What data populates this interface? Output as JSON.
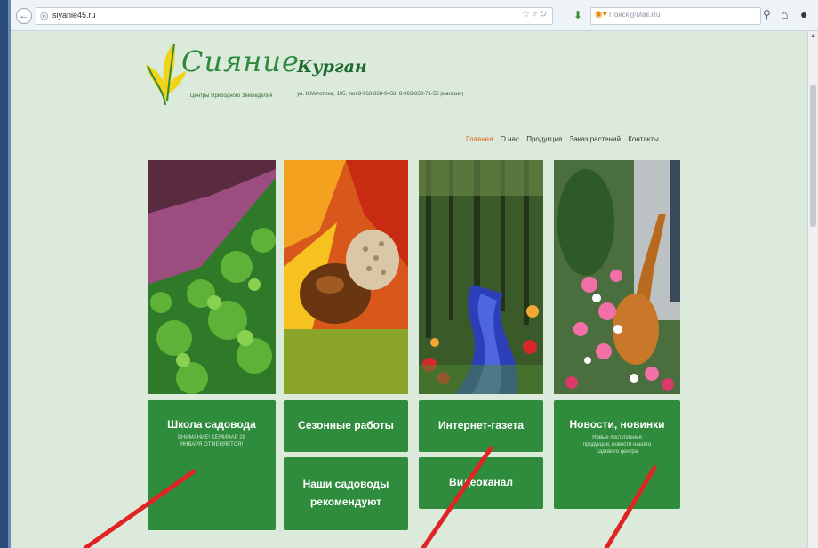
{
  "browser": {
    "url": "siyanie45.ru",
    "search_placeholder": "Поиск@Mail.Ru"
  },
  "site": {
    "logo_word": "Сияние",
    "logo_sub": "Центры Природного Земледелия",
    "city": "Курган",
    "address": "ул. К.Мяготина, 105, тел.8-963-868-0458, 8-963-838-71-55 (магазин)"
  },
  "nav": [
    "Главная",
    "О нас",
    "Продукция",
    "Заказ растений",
    "Контакты"
  ],
  "tiles": {
    "school_title": "Школа садовода",
    "school_sub": "ВНИМАНИЕ! СЕМИНАР 28 ЯНВАРЯ ОТМЕНЯЕТСЯ!",
    "seasonal": "Сезонные работы",
    "gardeners": "Наши садоводы рекомендуют",
    "newspaper": "Интернет-газета",
    "video": "Видеоканал",
    "news_title": "Новости, новинки",
    "news_sub": "Новые поступления продукции, новости нашего садового центра"
  },
  "colors": {
    "tile_green": "#2f8c3d",
    "active_nav": "#e06a1c",
    "page_bg": "#dceadb",
    "arrow_red": "#e02424"
  }
}
